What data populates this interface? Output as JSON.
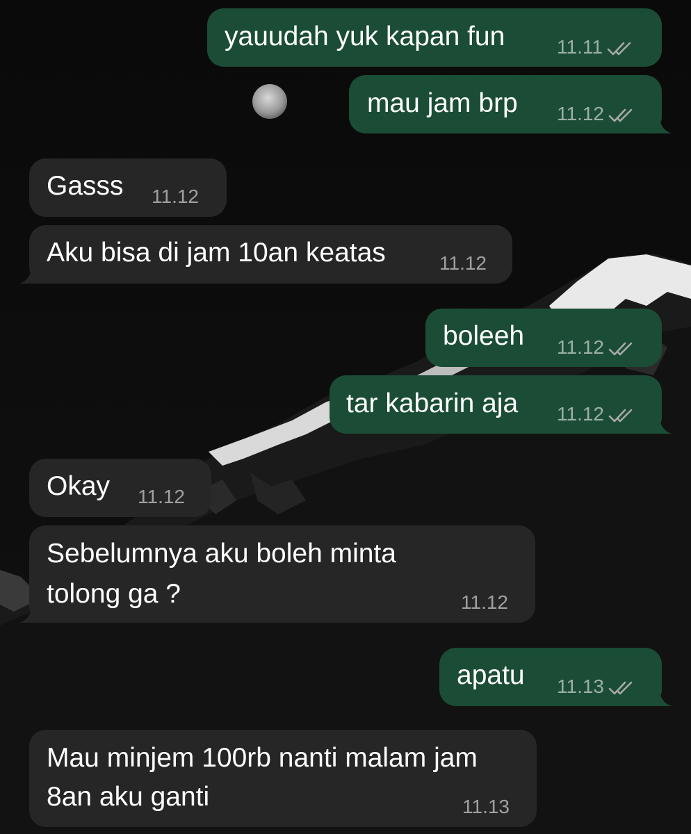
{
  "colors": {
    "outgoing_bubble": "#1b4d36",
    "incoming_bubble": "#262626",
    "text": "#ffffff",
    "meta_text": "#a8a8a8"
  },
  "wallpaper": {
    "icons": [
      "moon-icon",
      "snow-mountain-icon"
    ]
  },
  "messages": [
    {
      "id": "m1",
      "direction": "outgoing",
      "text": "yauudah yuk kapan fun",
      "time": "11.11",
      "status_icon": "double-check-icon"
    },
    {
      "id": "m2",
      "direction": "outgoing",
      "text": "mau jam brp",
      "time": "11.12",
      "status_icon": "double-check-icon"
    },
    {
      "id": "m3",
      "direction": "incoming",
      "text": "Gasss",
      "time": "11.12"
    },
    {
      "id": "m4",
      "direction": "incoming",
      "text": "Aku bisa di jam 10an keatas",
      "time": "11.12"
    },
    {
      "id": "m5",
      "direction": "outgoing",
      "text": "boleeh",
      "time": "11.12",
      "status_icon": "double-check-icon"
    },
    {
      "id": "m6",
      "direction": "outgoing",
      "text": "tar kabarin aja",
      "time": "11.12",
      "status_icon": "double-check-icon"
    },
    {
      "id": "m7",
      "direction": "incoming",
      "text": "Okay",
      "time": "11.12"
    },
    {
      "id": "m8",
      "direction": "incoming",
      "lines": [
        "Sebelumnya aku boleh minta",
        "tolong ga ?"
      ],
      "time": "11.12"
    },
    {
      "id": "m9",
      "direction": "outgoing",
      "text": "apatu",
      "time": "11.13",
      "status_icon": "double-check-icon"
    },
    {
      "id": "m10",
      "direction": "incoming",
      "lines": [
        "Mau minjem 100rb nanti malam jam",
        "8an aku ganti"
      ],
      "time": "11.13"
    }
  ]
}
